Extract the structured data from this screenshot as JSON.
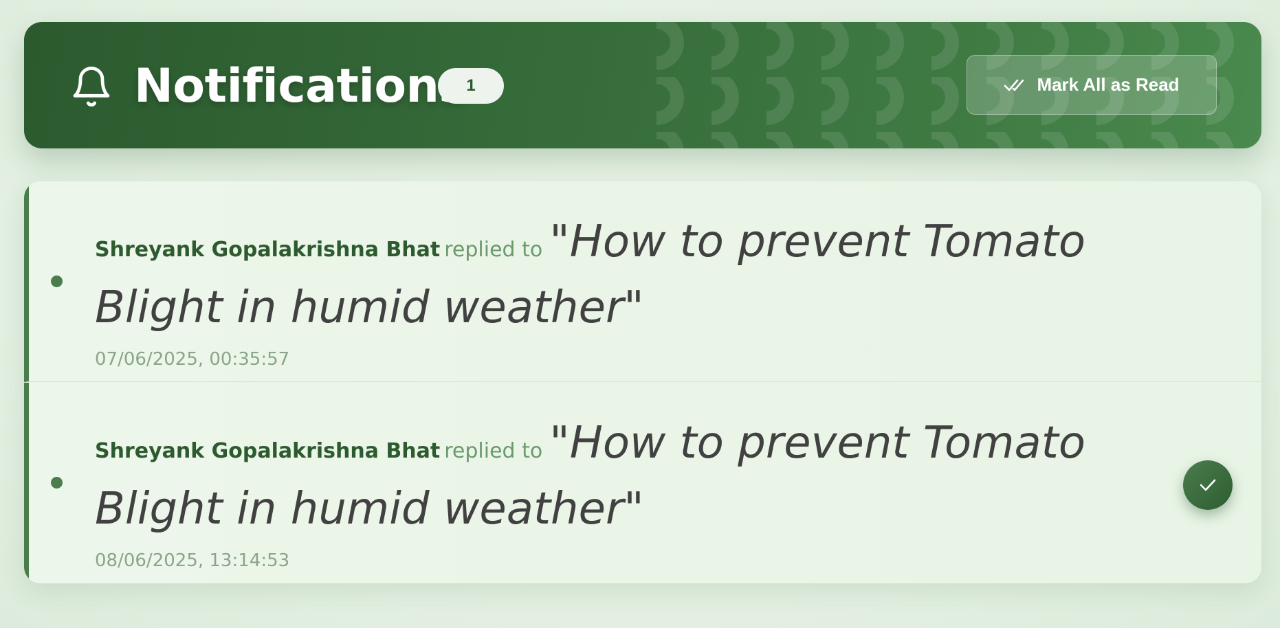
{
  "header": {
    "title": "Notifications",
    "unread_count": "1",
    "mark_all_label": "Mark All as Read"
  },
  "notifications": [
    {
      "user": "Shreyank Gopalakrishna Bhat",
      "action": "replied to",
      "post_title": "\"How to prevent Tomato Blight in humid weather\"",
      "timestamp": "07/06/2025, 00:35:57",
      "unread": true,
      "show_mark_read": false
    },
    {
      "user": "Shreyank Gopalakrishna Bhat",
      "action": "replied to",
      "post_title": "\"How to prevent Tomato Blight in humid weather\"",
      "timestamp": "08/06/2025, 13:14:53",
      "unread": true,
      "show_mark_read": true
    }
  ],
  "icons": {
    "header": "bell-icon",
    "mark_all": "double-check-icon",
    "mark_read": "check-icon"
  },
  "colors": {
    "primary": "#2b5a2e",
    "accent": "#4a7c4c",
    "background": "#e4f0e3",
    "text_dark": "#414141",
    "muted": "#8aa58a"
  }
}
